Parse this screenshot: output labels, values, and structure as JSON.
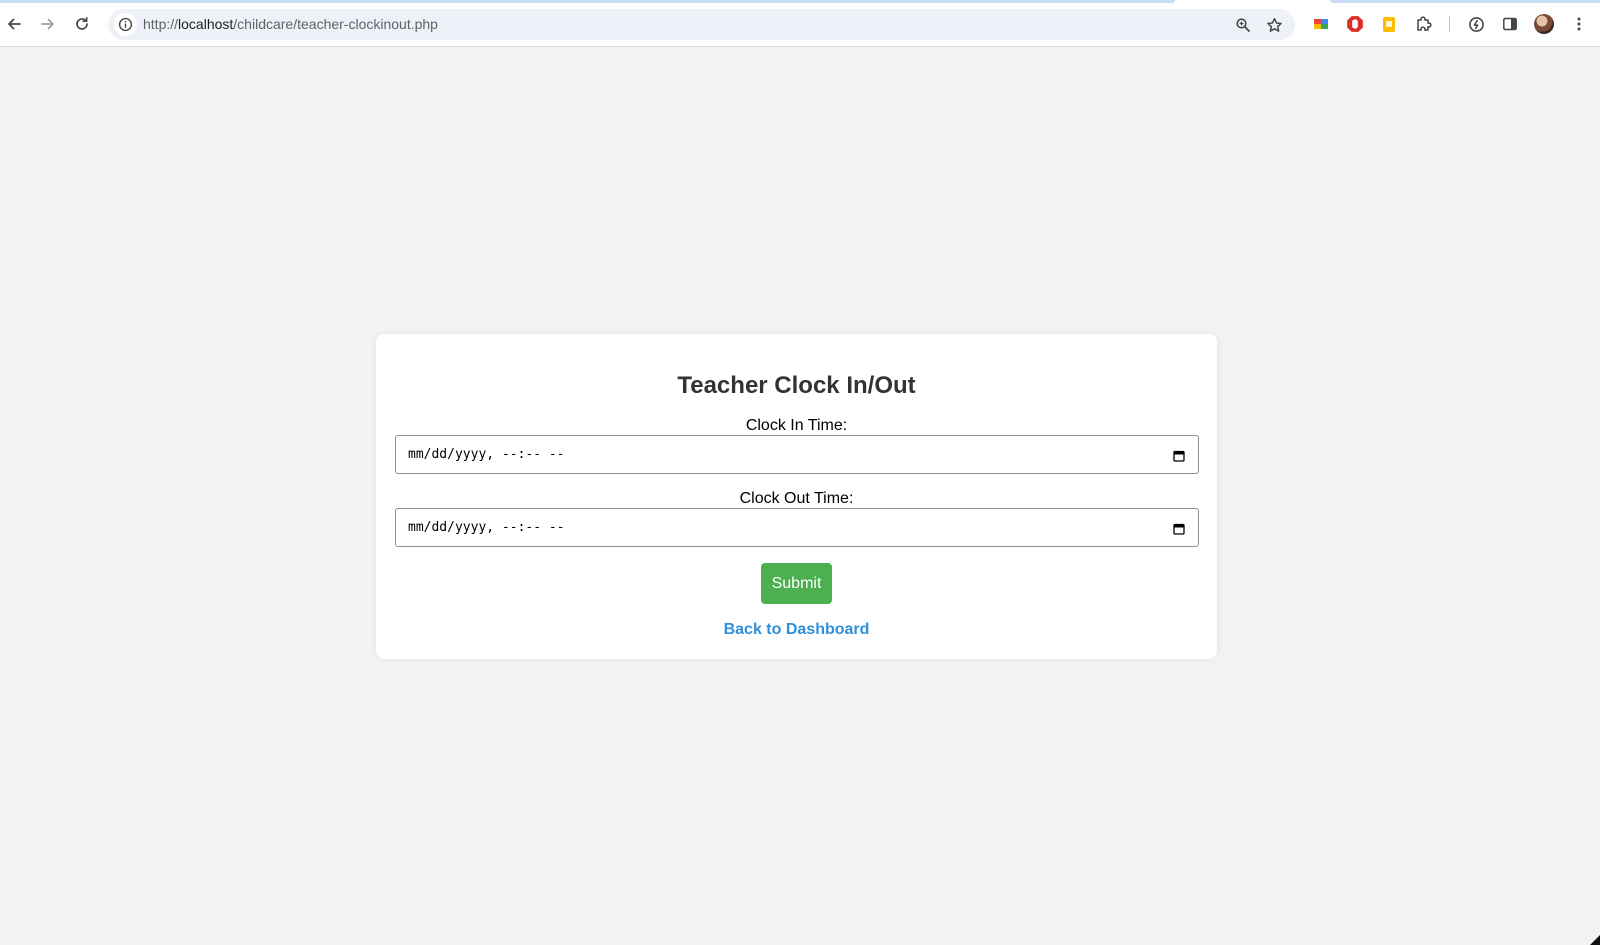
{
  "browser": {
    "url_prefix": "http://",
    "url_host": "localhost",
    "url_path": "/childcare/teacher-clockinout.php"
  },
  "icons": {
    "back": "back-arrow-icon",
    "forward": "forward-arrow-icon",
    "reload": "reload-icon",
    "info": "info-icon",
    "zoom": "zoom-icon",
    "bookmark": "star-icon",
    "extensions": "puzzle-icon",
    "calendar": "calendar-icon"
  },
  "form": {
    "title": "Teacher Clock In/Out",
    "clock_in_label": "Clock In Time:",
    "clock_in_value": "mm/dd/yyyy, --:-- --",
    "clock_out_label": "Clock Out Time:",
    "clock_out_value": "mm/dd/yyyy, --:-- --",
    "submit_label": "Submit",
    "back_link": "Back to Dashboard"
  },
  "colors": {
    "page_bg": "#f3f3f3",
    "card_bg": "#ffffff",
    "submit_bg": "#4caf50",
    "link": "#2f8fd8",
    "title": "#333333"
  }
}
